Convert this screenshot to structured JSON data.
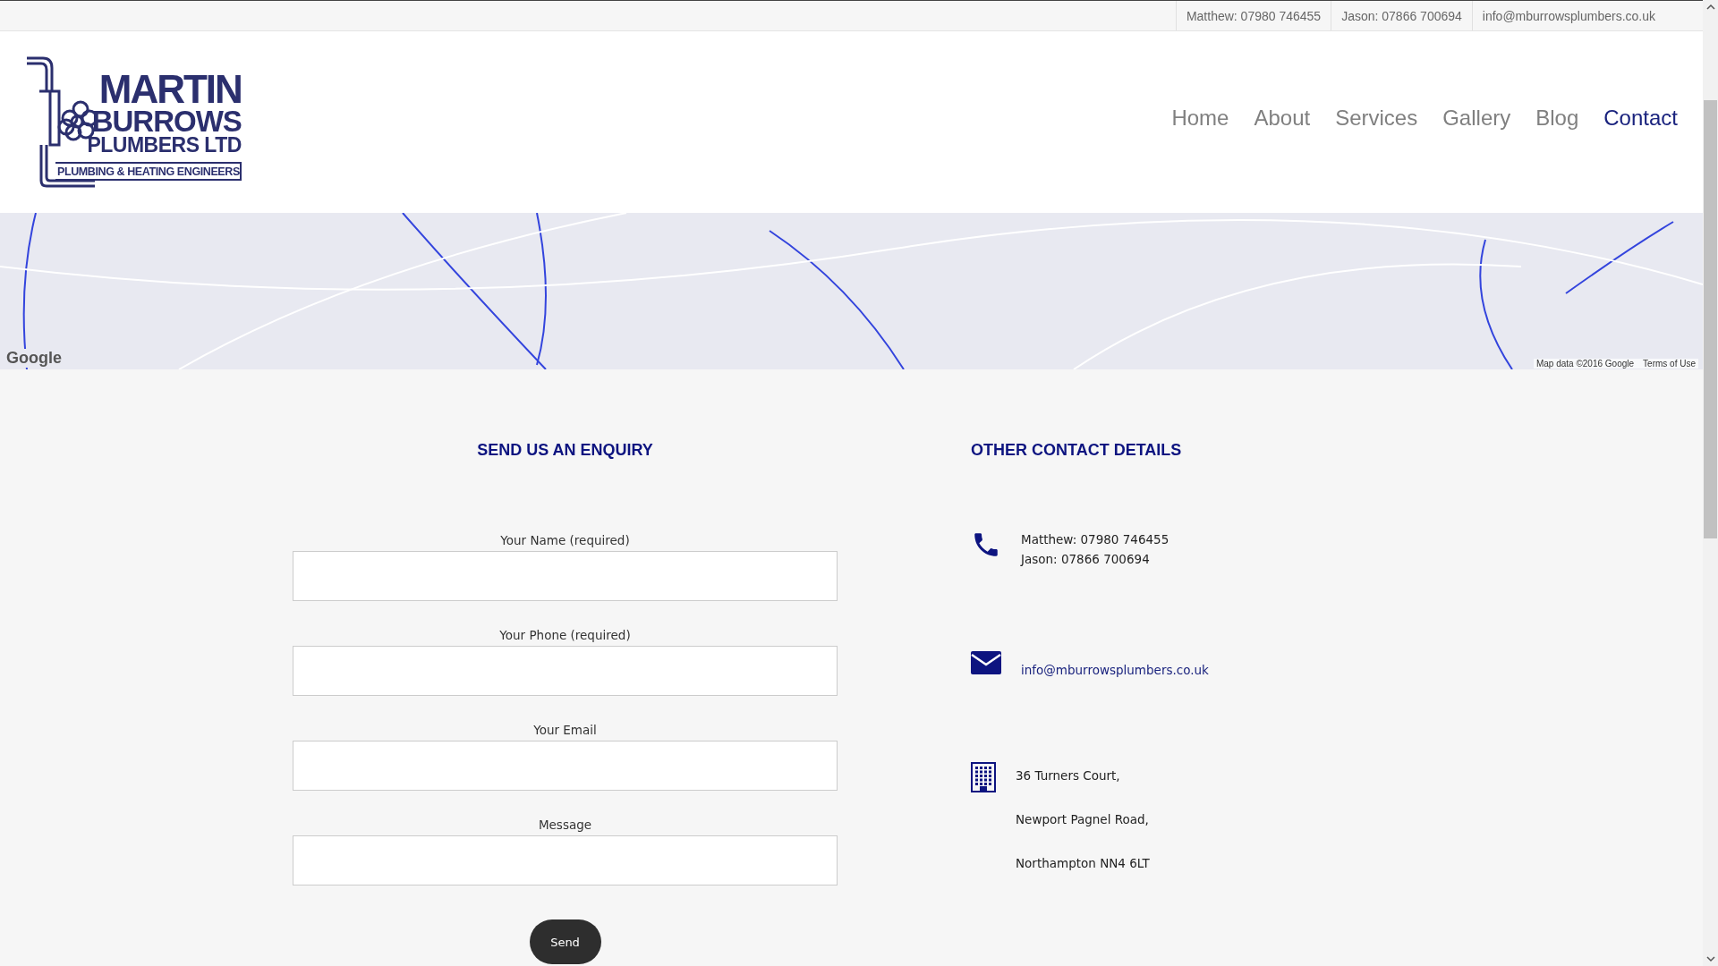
{
  "top_bar": {
    "items": [
      "Matthew: 07980 746455",
      "Jason: 07866 700694",
      "info@mburrowsplumbers.co.uk"
    ]
  },
  "logo": {
    "line_1": "MARTIN",
    "line_2": "BURROWS",
    "line_3": "PLUMBERS LTD",
    "tagline": "PLUMBING & HEATING ENGINEERS"
  },
  "nav": [
    {
      "label": "Home",
      "selected": false
    },
    {
      "label": "About",
      "selected": false
    },
    {
      "label": "Services",
      "selected": false
    },
    {
      "label": "Gallery",
      "selected": false
    },
    {
      "label": "Blog",
      "selected": false
    },
    {
      "label": "Contact",
      "selected": true
    }
  ],
  "map": {
    "logo": "Google",
    "attribution": "Map data ©2016 Google",
    "terms_link": "Terms of Use"
  },
  "enquiry": {
    "heading": "SEND US AN ENQUIRY",
    "fields": [
      {
        "label": "Your Name (required)"
      },
      {
        "label": "Your Phone (required)"
      },
      {
        "label": "Your Email"
      },
      {
        "label": "Message"
      }
    ],
    "submit": "Send"
  },
  "contact": {
    "heading": "OTHER CONTACT DETAILS",
    "items": [
      {
        "kind": "phone",
        "lines": [
          "Matthew: 07980 746455",
          "Jason: 07866 700694"
        ]
      },
      {
        "kind": "email",
        "lines": [
          "info@mburrowsplumbers.co.uk"
        ]
      },
      {
        "kind": "address",
        "lines": [
          "36 Turners Court,",
          "Newport Pagnel Road,",
          "Northampton NN4 6LT"
        ]
      }
    ]
  }
}
